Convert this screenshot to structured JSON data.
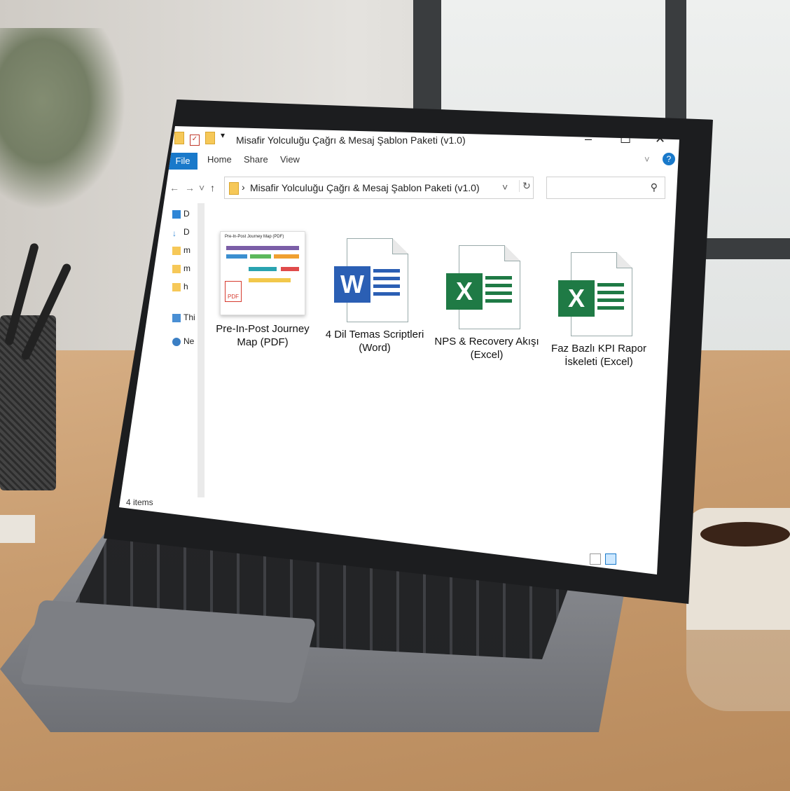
{
  "window": {
    "title": "Misafir Yolculuğu Çağrı & Mesaj Şablon Paketi (v1.0)",
    "minimize": "–",
    "maximize": "☐",
    "close": "✕"
  },
  "ribbon": {
    "tabs": [
      "File",
      "Home",
      "Share",
      "View"
    ],
    "expand": "˅",
    "help": "?"
  },
  "address": {
    "back": "←",
    "forward": "→",
    "recent": "˅",
    "up": "↑",
    "separator": "›",
    "path": "Misafir Yolculuğu Çağrı & Mesaj Şablon Paketi (v1.0)",
    "dropdown": "˅",
    "refresh": "↻"
  },
  "search": {
    "placeholder": "",
    "icon": "search-icon"
  },
  "nav_pane": {
    "items": [
      {
        "label": "D",
        "icon": "desktop-icon"
      },
      {
        "label": "D",
        "icon": "downloads-icon"
      },
      {
        "label": "m",
        "icon": "folder-icon"
      },
      {
        "label": "m",
        "icon": "folder-icon"
      },
      {
        "label": "h",
        "icon": "folder-icon"
      },
      {
        "label": "Thi",
        "icon": "this-pc-icon"
      },
      {
        "label": "Ne",
        "icon": "network-icon"
      }
    ]
  },
  "files": [
    {
      "name": "Pre-In-Post Journey Map (PDF)",
      "type": "pdf",
      "thumb_title": "Pre-In-Post Journey Map (PDF)",
      "thumb_badge": "PDF"
    },
    {
      "name": "4 Dil Temas Scriptleri (Word)",
      "type": "word",
      "badge": "W"
    },
    {
      "name": "NPS & Recovery Akışı (Excel)",
      "type": "excel",
      "badge": "X"
    },
    {
      "name": "Faz Bazlı KPI Rapor İskeleti (Excel)",
      "type": "excel",
      "badge": "X"
    }
  ],
  "status": {
    "count": "4 items"
  },
  "colors": {
    "accent": "#1979ca",
    "word": "#2b5fb4",
    "excel": "#1f7a45",
    "pdf": "#d63b2f"
  }
}
